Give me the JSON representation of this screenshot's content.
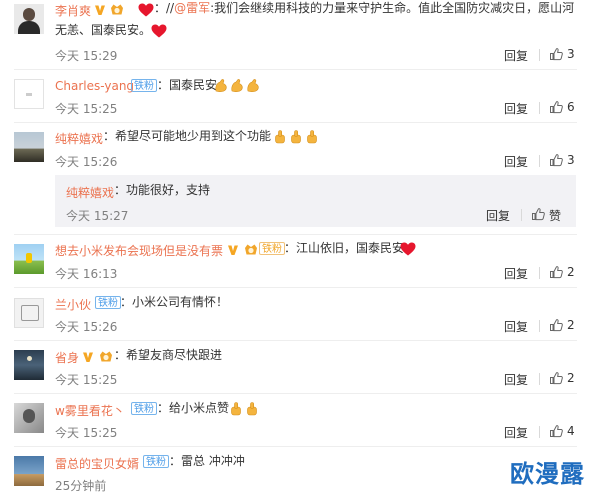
{
  "actions": {
    "reply_label": "回复",
    "like_label": "赞"
  },
  "badges": {
    "tiefen": "铁粉",
    "vip_level_text": "5",
    "fans_label": "铁粉"
  },
  "comments": [
    {
      "name": "李肖爽",
      "text_line1": "：//@雷军:我们会继续用科技的力量来守护生命。值此全国防灾减灾日，愿山河",
      "mention": "@雷军",
      "text_line2": "无恙、国泰民安。",
      "time": "今天 15:29",
      "likes": "3"
    },
    {
      "name": "Charles-yang",
      "text": "：国泰民安",
      "time": "今天 15:25",
      "likes": "6"
    },
    {
      "name": "纯粹嬉戏",
      "text": "：希望尽可能地少用到这个功能",
      "time": "今天 15:26",
      "likes": "3"
    },
    {
      "name": "想去小米发布会现场但是没有票",
      "text": "：江山依旧，国泰民安",
      "time": "今天 16:13",
      "likes": "2"
    },
    {
      "name": "兰小伙",
      "text": "：小米公司有情怀！",
      "time": "今天 15:26",
      "likes": "2"
    },
    {
      "name": "省身",
      "text": "：希望友商尽快跟进",
      "time": "今天 15:25",
      "likes": "2"
    },
    {
      "name": "w雾里看花丶",
      "text": "：给小米点赞",
      "time": "今天 15:25",
      "likes": "4"
    },
    {
      "name": "雷总的宝贝女婿",
      "text": "：雷总 冲冲冲",
      "time": "25分钟前",
      "likes": ""
    }
  ],
  "nested_reply": {
    "name": "纯粹嬉戏",
    "text": "：功能很好，支持",
    "time": "今天 15:27"
  },
  "watermark": "欧漫露",
  "colors": {
    "username": "#eb7350",
    "badge_blue": "#4d9de8",
    "heart_red": "#e6162d",
    "verified_orange": "#f5a623"
  }
}
